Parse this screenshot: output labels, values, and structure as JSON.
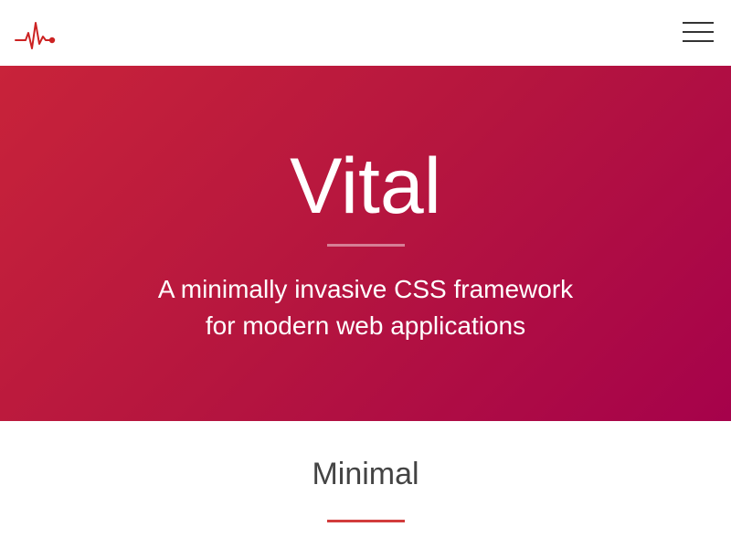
{
  "header": {
    "logo_icon": "heartbeat-pulse-icon",
    "menu_icon": "hamburger-menu-icon",
    "brand_color": "#cc2222"
  },
  "hero": {
    "title": "Vital",
    "subtitle_line1": "A minimally invasive CSS framework",
    "subtitle_line2": "for modern web applications",
    "gradient_start": "#c8233a",
    "gradient_end": "#a6024b"
  },
  "section": {
    "title": "Minimal",
    "accent_color": "#d23c3c"
  }
}
